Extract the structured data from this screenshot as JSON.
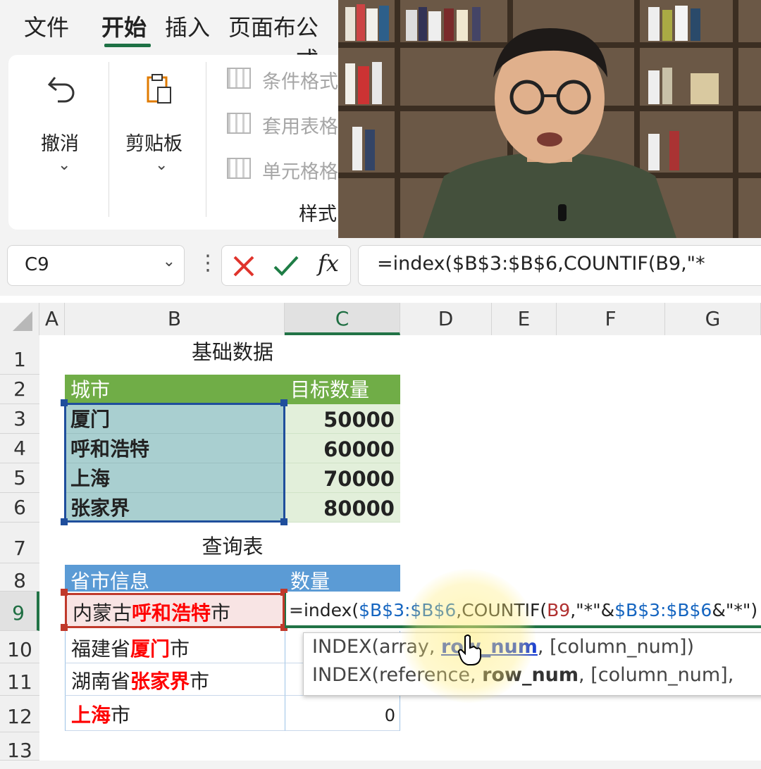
{
  "ribbon_tabs": [
    "文件",
    "开始",
    "插入",
    "页面布",
    "公式"
  ],
  "ribbon": {
    "undo_label": "撤消",
    "clipboard_label": "剪贴板",
    "style_items": [
      "条件格式",
      "套用表格",
      "单元格格"
    ],
    "group_label": "样式"
  },
  "name_box": "C9",
  "formula_bar_text": "=index($B$3:$B$6,COUNTIF(B9,\"*",
  "columns": [
    "A",
    "B",
    "C",
    "D",
    "E",
    "F",
    "G"
  ],
  "rows": [
    "1",
    "2",
    "3",
    "4",
    "5",
    "6",
    "7",
    "8",
    "9",
    "10",
    "11",
    "12",
    "13"
  ],
  "basic_table": {
    "title": "基础数据",
    "header": [
      "城市",
      "目标数量"
    ],
    "cities": [
      "厦门",
      "呼和浩特",
      "上海",
      "张家界"
    ],
    "values": [
      "50000",
      "60000",
      "70000",
      "80000"
    ]
  },
  "query_table": {
    "title": "查询表",
    "header": [
      "省市信息",
      "数量"
    ],
    "rows": [
      {
        "pre": "内蒙古",
        "city": "呼和浩特",
        "post": "市"
      },
      {
        "pre": "福建省",
        "city": "厦门",
        "post": "市"
      },
      {
        "pre": "湖南省",
        "city": "张家界",
        "post": "市"
      },
      {
        "pre": "",
        "city": "上海",
        "post": "市"
      }
    ],
    "last_value": "0"
  },
  "cell_formula": {
    "p1": "=index(",
    "p2": "$B$3:$B$6",
    "p3": ",COUNTIF(",
    "p4": "B9",
    "p5": ",\"*\"&",
    "p6": "$B$3:$B$6",
    "p7": "&\"*\")"
  },
  "tooltip": {
    "line1": {
      "fn": "INDEX(",
      "a1": "array",
      "c1": ", ",
      "a2": "row_num",
      "rest": ", [column_num])"
    },
    "line2": {
      "fn": "INDEX(",
      "a1": "reference",
      "c1": ", ",
      "a2": "row_num",
      "rest": ", [column_num],"
    }
  }
}
